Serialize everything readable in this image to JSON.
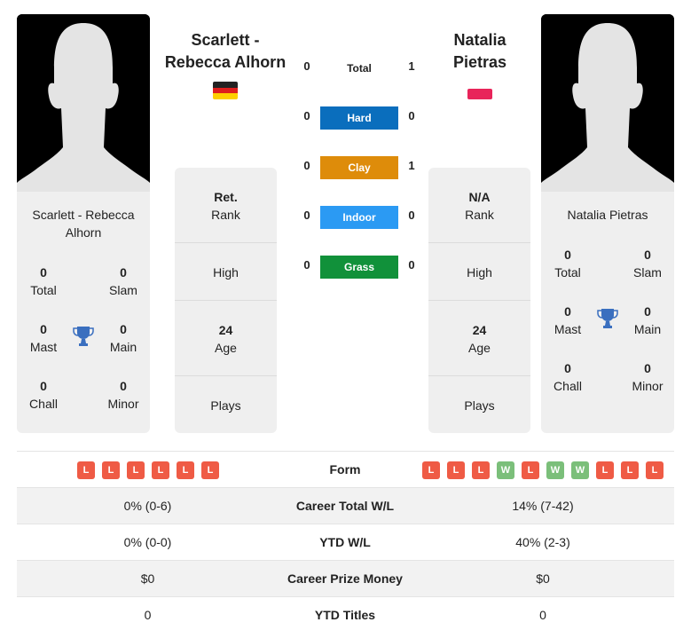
{
  "colors": {
    "hard": "#0a6ebd",
    "clay": "#de8c0a",
    "indoor": "#2b9af3",
    "grass": "#11913a",
    "loss": "#ef5b45",
    "win": "#7bbf7a",
    "trophy": "#3a6fbf"
  },
  "player1": {
    "name_header": [
      "Scarlett -",
      "Rebecca Alhorn"
    ],
    "card_name": [
      "Scarlett - Rebecca",
      "Alhorn"
    ],
    "flag": "germany-flag",
    "stats": {
      "total": {
        "value": "0",
        "label": "Total"
      },
      "slam": {
        "value": "0",
        "label": "Slam"
      },
      "mast": {
        "value": "0",
        "label": "Mast"
      },
      "main": {
        "value": "0",
        "label": "Main"
      },
      "chall": {
        "value": "0",
        "label": "Chall"
      },
      "minor": {
        "value": "0",
        "label": "Minor"
      }
    },
    "info": {
      "rank_value": "Ret.",
      "rank_label": "Rank",
      "high_label": "High",
      "age_value": "24",
      "age_label": "Age",
      "plays_label": "Plays"
    },
    "form": [
      "L",
      "L",
      "L",
      "L",
      "L",
      "L"
    ],
    "career_wl": "0% (0-6)",
    "ytd_wl": "0% (0-0)",
    "prize_money": "$0",
    "ytd_titles": "0"
  },
  "player2": {
    "name_header": [
      "Natalia",
      "Pietras"
    ],
    "card_name": [
      "Natalia Pietras"
    ],
    "flag": "poland-flag",
    "stats": {
      "total": {
        "value": "0",
        "label": "Total"
      },
      "slam": {
        "value": "0",
        "label": "Slam"
      },
      "mast": {
        "value": "0",
        "label": "Mast"
      },
      "main": {
        "value": "0",
        "label": "Main"
      },
      "chall": {
        "value": "0",
        "label": "Chall"
      },
      "minor": {
        "value": "0",
        "label": "Minor"
      }
    },
    "info": {
      "rank_value": "N/A",
      "rank_label": "Rank",
      "high_label": "High",
      "age_value": "24",
      "age_label": "Age",
      "plays_label": "Plays"
    },
    "form": [
      "L",
      "L",
      "L",
      "W",
      "L",
      "W",
      "W",
      "L",
      "L",
      "L"
    ],
    "career_wl": "14% (7-42)",
    "ytd_wl": "40% (2-3)",
    "prize_money": "$0",
    "ytd_titles": "0"
  },
  "h2h": {
    "total": {
      "label": "Total",
      "p1": "0",
      "p2": "1"
    },
    "hard": {
      "label": "Hard",
      "p1": "0",
      "p2": "0"
    },
    "clay": {
      "label": "Clay",
      "p1": "0",
      "p2": "1"
    },
    "indoor": {
      "label": "Indoor",
      "p1": "0",
      "p2": "0"
    },
    "grass": {
      "label": "Grass",
      "p1": "0",
      "p2": "0"
    }
  },
  "table": {
    "form_label": "Form",
    "career_wl_label": "Career Total W/L",
    "ytd_wl_label": "YTD W/L",
    "prize_label": "Career Prize Money",
    "titles_label": "YTD Titles"
  }
}
